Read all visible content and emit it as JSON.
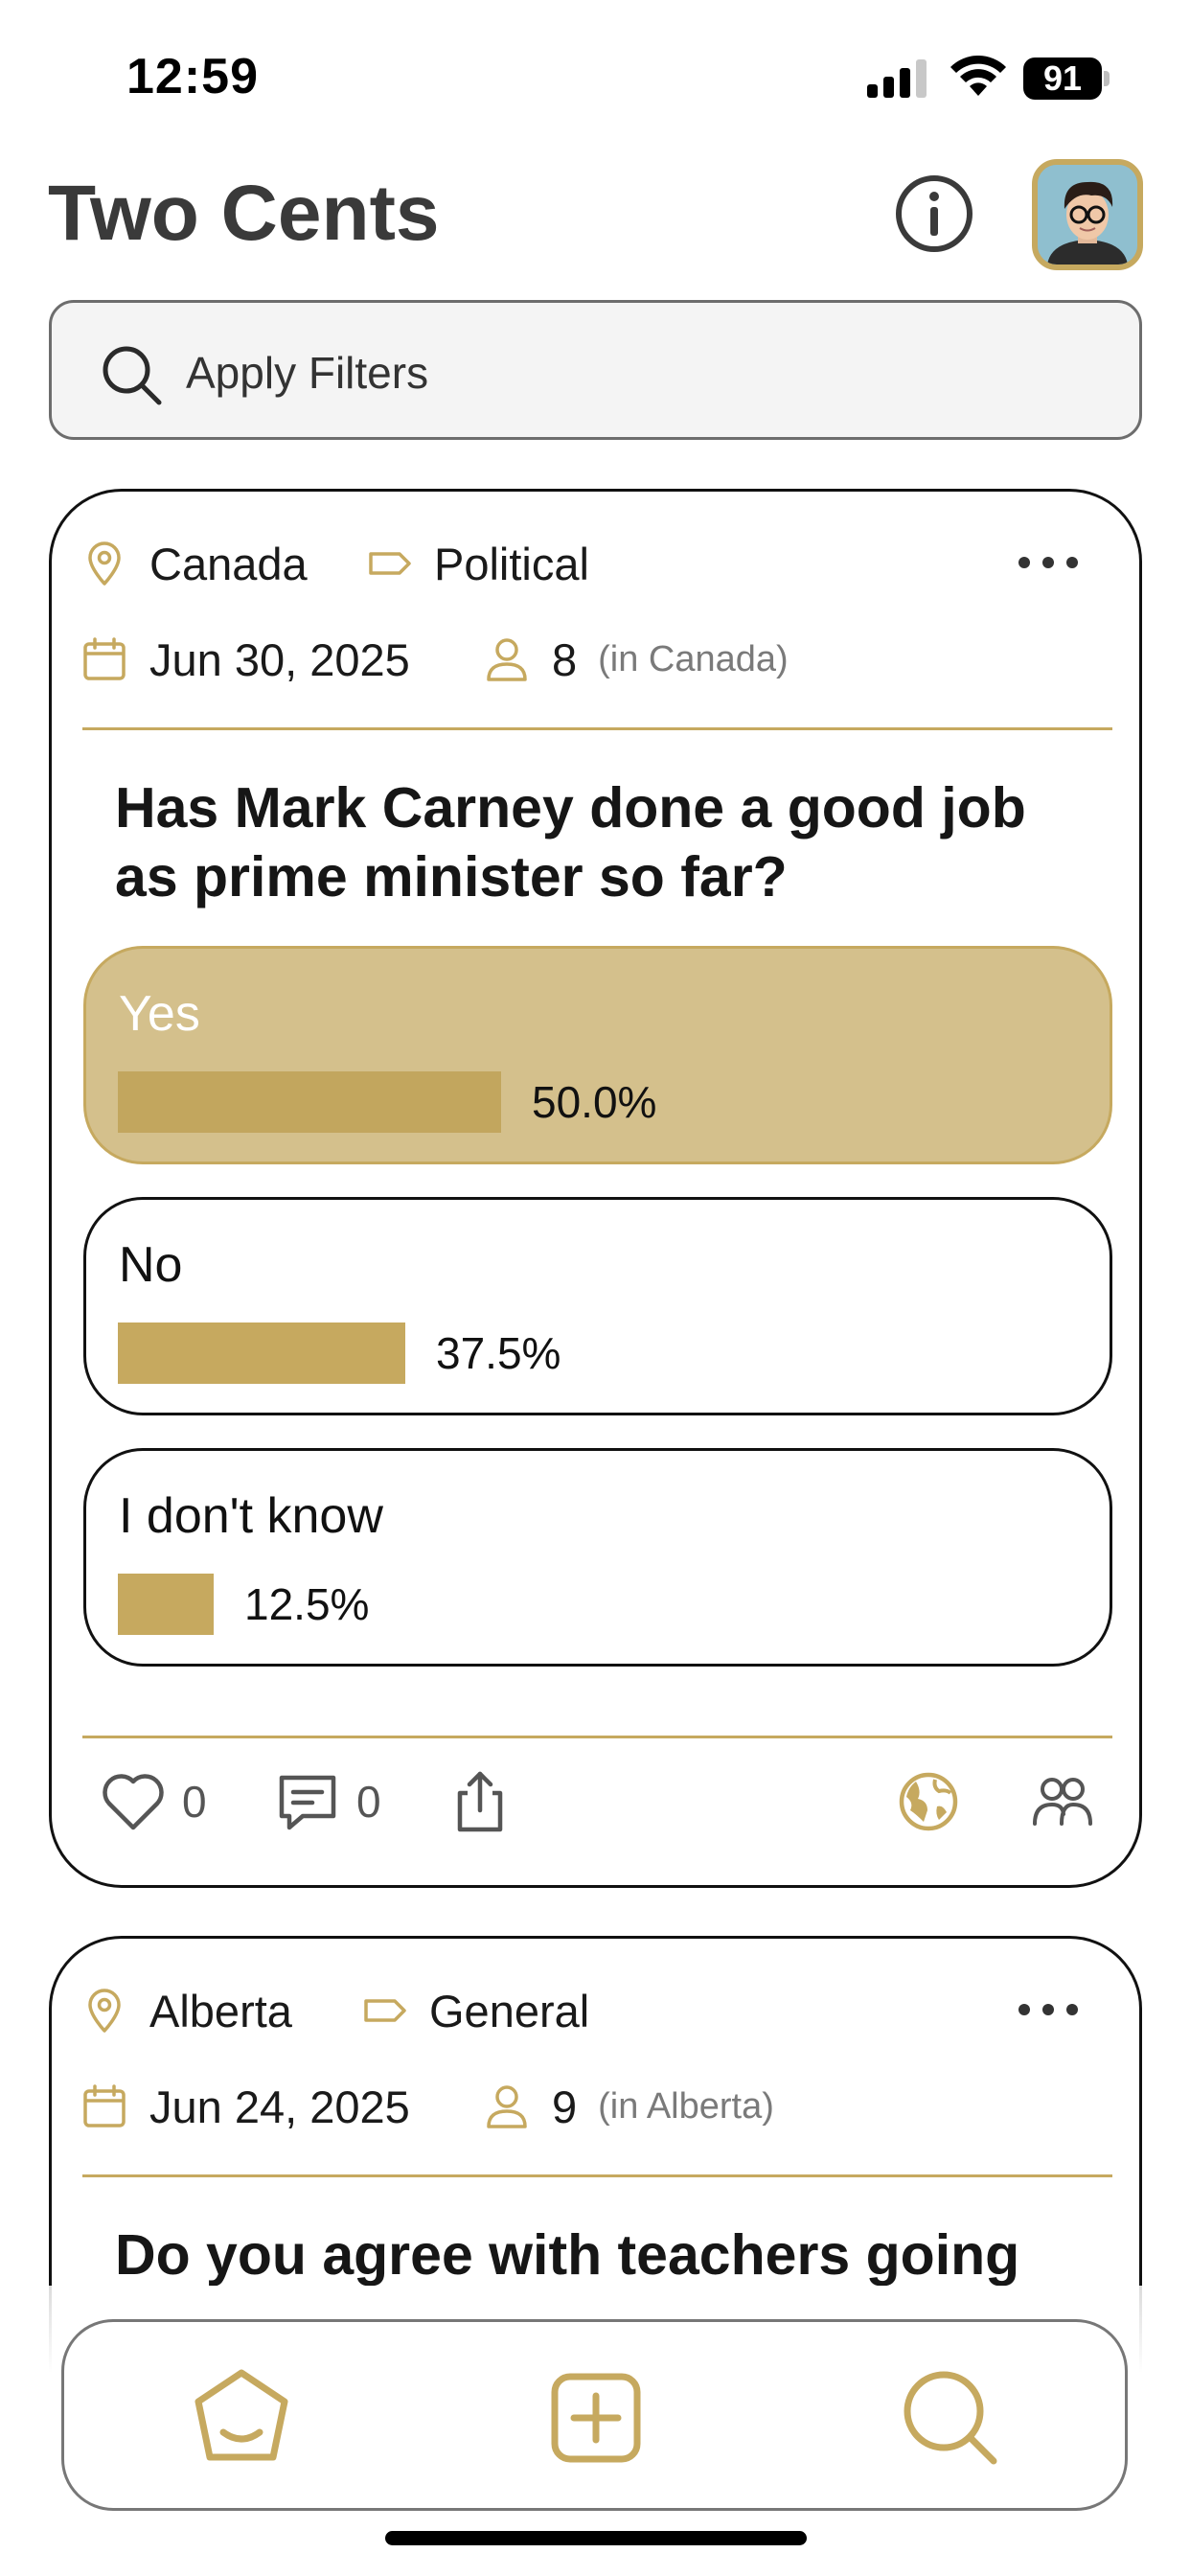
{
  "status_bar": {
    "time": "12:59",
    "battery": "91"
  },
  "header": {
    "title": "Two Cents"
  },
  "search": {
    "placeholder": "Apply Filters"
  },
  "colors": {
    "accent_gold": "#c6a95f",
    "selected_fill": "#d4c08c",
    "text_dark": "#3a3a3a"
  },
  "polls": [
    {
      "location": "Canada",
      "category": "Political",
      "date": "Jun 30, 2025",
      "respondents": "8",
      "respondents_scope": "(in Canada)",
      "question": "Has Mark Carney done a good job as prime minister so far?",
      "options": [
        {
          "label": "Yes",
          "percent_label": "50.0%",
          "percent": 50.0,
          "selected": true
        },
        {
          "label": "No",
          "percent_label": "37.5%",
          "percent": 37.5,
          "selected": false
        },
        {
          "label": "I don't know",
          "percent_label": "12.5%",
          "percent": 12.5,
          "selected": false
        }
      ],
      "likes": "0",
      "comments": "0"
    },
    {
      "location": "Alberta",
      "category": "General",
      "date": "Jun 24, 2025",
      "respondents": "9",
      "respondents_scope": "(in Alberta)",
      "question": "Do you agree with teachers going"
    }
  ],
  "icons": [
    "location-pin-icon",
    "tag-icon",
    "calendar-icon",
    "person-icon",
    "more-dots-icon",
    "heart-icon",
    "comment-icon",
    "share-icon",
    "globe-icon",
    "group-icon",
    "home-icon",
    "add-icon",
    "search-icon",
    "info-icon"
  ],
  "tab_bar": {
    "tabs": [
      "home",
      "create",
      "search"
    ]
  }
}
